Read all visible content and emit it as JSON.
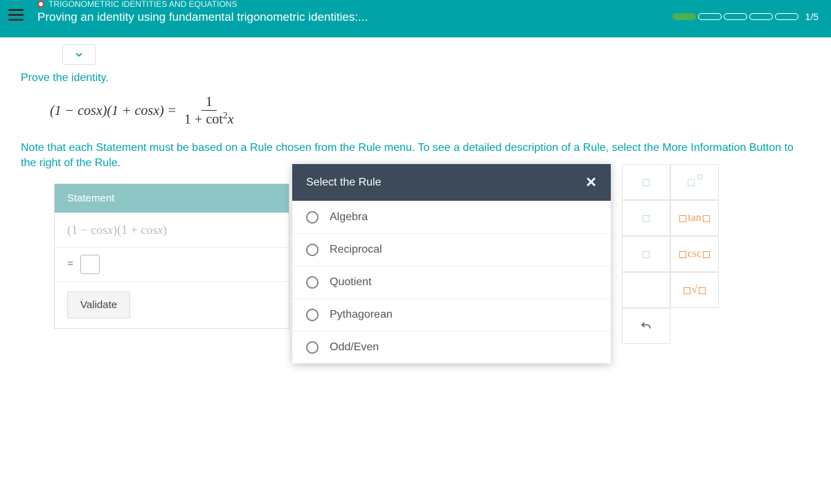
{
  "header": {
    "breadcrumb": "TRIGONOMETRIC IDENTITIES AND EQUATIONS",
    "title": "Proving an identity using fundamental trigonometric identities:...",
    "progress_label": "1/5",
    "progress_total": 5,
    "progress_filled": 1
  },
  "body": {
    "prove": "Prove the identity.",
    "identity_lhs": "(1 − cos x)(1 + cos x)",
    "identity_eq": "=",
    "identity_num": "1",
    "identity_den_pre": "1 + cot",
    "identity_den_exp": "2",
    "identity_den_post": "x",
    "note": "Note that each Statement must be based on a Rule chosen from the Rule menu. To see a detailed description of a Rule, select the More Information Button to the right of the Rule."
  },
  "statement": {
    "header": "Statement",
    "row1": "(1 − cos x)(1 + cos x)",
    "row2_eq": "=",
    "validate": "Validate"
  },
  "rule_modal": {
    "title": "Select the Rule",
    "options": [
      "Algebra",
      "Reciprocal",
      "Quotient",
      "Pythagorean",
      "Odd/Even"
    ]
  },
  "tools": {
    "tan": "tan",
    "csc": "csc"
  }
}
